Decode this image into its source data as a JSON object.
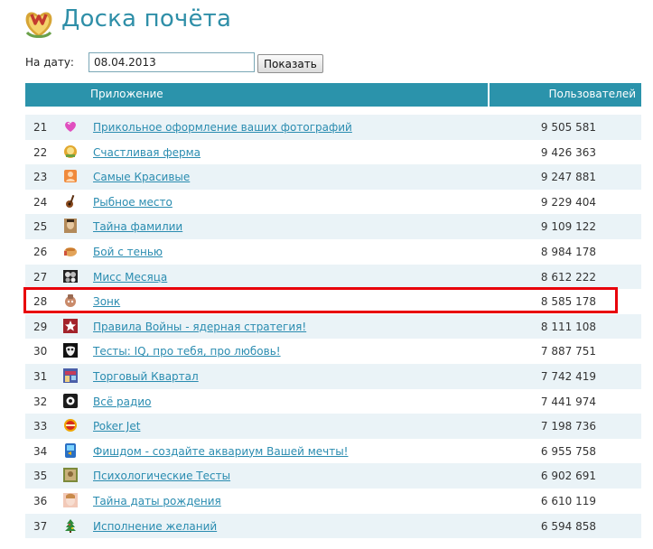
{
  "page": {
    "title": "Доска почёта"
  },
  "filter": {
    "date_label": "На дату:",
    "date_value": "08.04.2013",
    "show_label": "Показать"
  },
  "table": {
    "col_app": "Приложение",
    "col_users": "Пользователей",
    "rows": [
      {
        "rank": "21",
        "name": "Прикольное оформление ваших фотографий",
        "users": "9 505 581",
        "icon": "heart-icon"
      },
      {
        "rank": "22",
        "name": "Счастливая ферма",
        "users": "9 426 363",
        "icon": "farm-icon"
      },
      {
        "rank": "23",
        "name": "Самые Красивые",
        "users": "9 247 881",
        "icon": "beauty-icon"
      },
      {
        "rank": "24",
        "name": "Рыбное место",
        "users": "9 229 404",
        "icon": "fishing-icon"
      },
      {
        "rank": "25",
        "name": "Тайна фамилии",
        "users": "9 109 122",
        "icon": "portrait-icon"
      },
      {
        "rank": "26",
        "name": "Бой с тенью",
        "users": "8 984 178",
        "icon": "fist-icon"
      },
      {
        "rank": "27",
        "name": "Мисс Месяца",
        "users": "8 612 222",
        "icon": "faces-icon"
      },
      {
        "rank": "28",
        "name": "Зонк",
        "users": "8 585 178",
        "icon": "zonk-icon"
      },
      {
        "rank": "29",
        "name": "Правила Войны - ядерная стратегия!",
        "users": "8 111 108",
        "icon": "star-icon"
      },
      {
        "rank": "30",
        "name": "Тесты: IQ, про тебя, про любовь!",
        "users": "7 887 751",
        "icon": "mask-icon"
      },
      {
        "rank": "31",
        "name": "Торговый Квартал",
        "users": "7 742 419",
        "icon": "shop-icon"
      },
      {
        "rank": "32",
        "name": "Всё радио",
        "users": "7 441 974",
        "icon": "radio-icon"
      },
      {
        "rank": "33",
        "name": "Poker Jet",
        "users": "7 198 736",
        "icon": "poker-chip-icon"
      },
      {
        "rank": "34",
        "name": "Фишдом - создайте аквариум Вашей мечты!",
        "users": "6 955 758",
        "icon": "aquarium-icon"
      },
      {
        "rank": "35",
        "name": "Психологические Тесты",
        "users": "6 902 691",
        "icon": "psych-icon"
      },
      {
        "rank": "36",
        "name": "Тайна даты рождения",
        "users": "6 610 119",
        "icon": "face-icon"
      },
      {
        "rank": "37",
        "name": "Исполнение желаний",
        "users": "6 594 858",
        "icon": "tree-icon"
      }
    ]
  },
  "highlight": {
    "rank": "28",
    "color": "#e8000a"
  },
  "colors": {
    "accent": "#2b93ab",
    "link": "#2a8cb0",
    "title": "#2f8fa8",
    "row_alt": "#eaf3f7"
  }
}
